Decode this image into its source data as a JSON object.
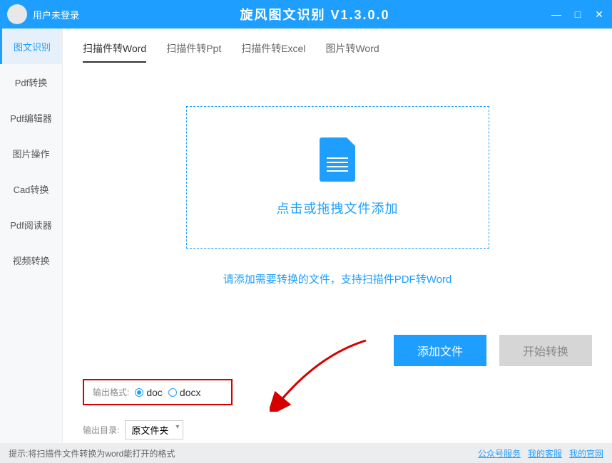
{
  "titlebar": {
    "user_status": "用户未登录",
    "app_title": "旋风图文识别 V1.3.0.0"
  },
  "sidebar": {
    "items": [
      {
        "label": "图文识别",
        "active": true
      },
      {
        "label": "Pdf转换",
        "active": false
      },
      {
        "label": "Pdf编辑器",
        "active": false
      },
      {
        "label": "图片操作",
        "active": false
      },
      {
        "label": "Cad转换",
        "active": false
      },
      {
        "label": "Pdf阅读器",
        "active": false
      },
      {
        "label": "视频转换",
        "active": false
      }
    ]
  },
  "tabs": [
    {
      "label": "扫描件转Word",
      "active": true
    },
    {
      "label": "扫描件转Ppt",
      "active": false
    },
    {
      "label": "扫描件转Excel",
      "active": false
    },
    {
      "label": "图片转Word",
      "active": false
    }
  ],
  "dropzone": {
    "text": "点击或拖拽文件添加"
  },
  "hint": "请添加需要转换的文件，支持扫描件PDF转Word",
  "buttons": {
    "add_file": "添加文件",
    "start_convert": "开始转换"
  },
  "output_format": {
    "label": "输出格式:",
    "options": [
      {
        "value": "doc",
        "checked": true
      },
      {
        "value": "docx",
        "checked": false
      }
    ]
  },
  "output_dir": {
    "label": "输出目录:",
    "selected": "原文件夹"
  },
  "statusbar": {
    "tip": "提示:将扫描件文件转换为word能打开的格式",
    "links": [
      "公众号服务",
      "我的客服",
      "我的官网"
    ]
  }
}
